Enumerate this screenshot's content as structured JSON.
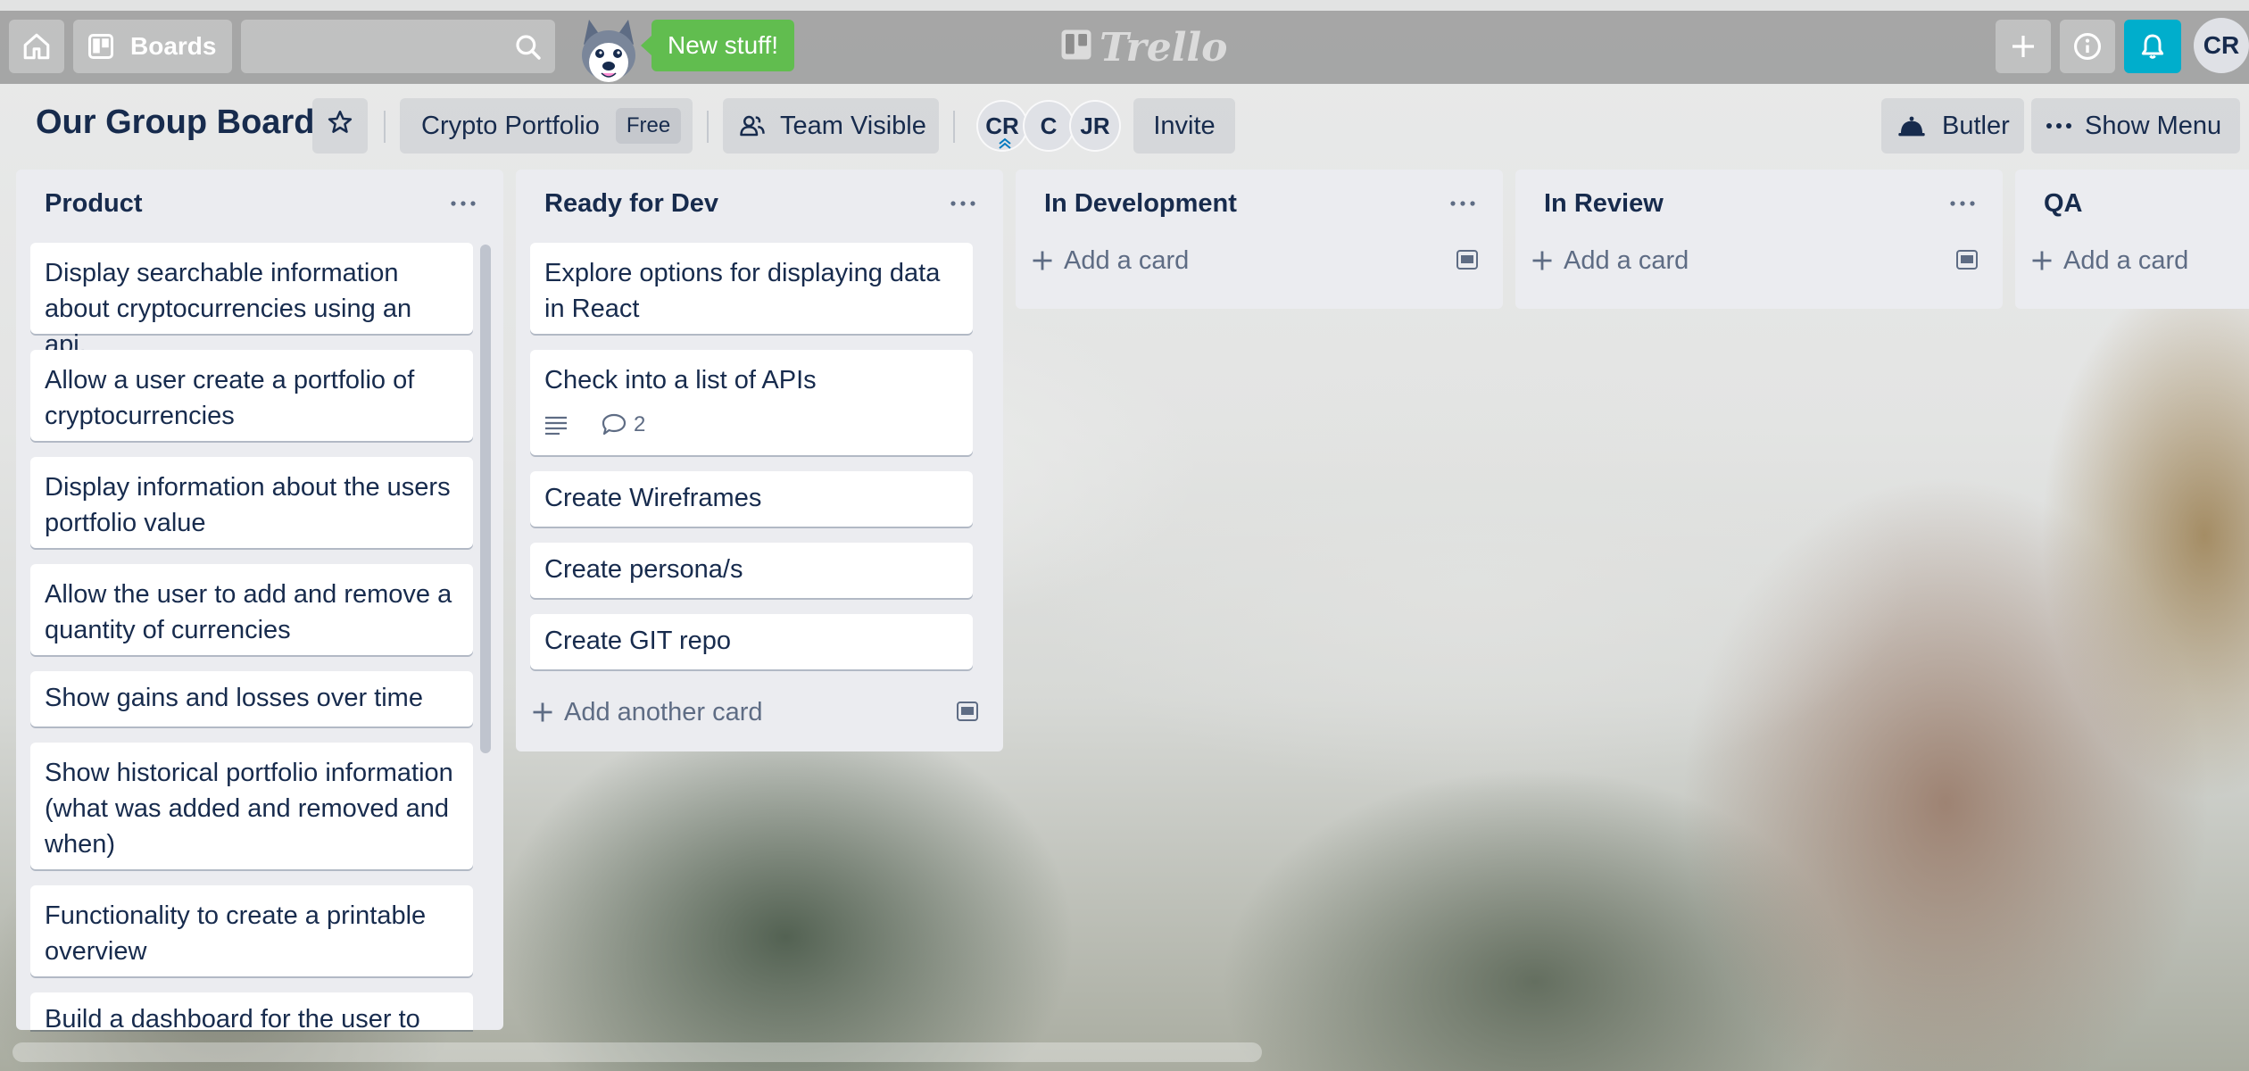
{
  "header": {
    "home_icon": "home-icon",
    "boards_label": "Boards",
    "search": {
      "value": "",
      "placeholder": ""
    },
    "new_stuff_label": "New stuff!",
    "logo_text": "Trello",
    "user_initials": "CR"
  },
  "board": {
    "title": "Our Group Board",
    "workspace_name": "Crypto Portfolio",
    "workspace_badge": "Free",
    "visibility_label": "Team Visible",
    "members": [
      "CR",
      "C",
      "JR"
    ],
    "invite_label": "Invite",
    "butler_label": "Butler",
    "show_menu_label": "Show Menu"
  },
  "lists": [
    {
      "title": "Product",
      "cards": [
        "Display searchable information about cryptocurrencies using an api.",
        "Allow a user create a portfolio of cryptocurrencies",
        "Display information about the users portfolio value",
        "Allow the user to add and remove a quantity of currencies",
        "Show gains and losses over time",
        "Show historical portfolio information (what was added and removed and when)",
        "Functionality to create a printable overview",
        "Build a dashboard for the user to"
      ]
    },
    {
      "title": "Ready for Dev",
      "cards": [
        "Explore options for displaying data in React",
        "Check into a list of APIs",
        "Create Wireframes",
        "Create persona/s",
        "Create GIT repo"
      ],
      "card2_comment_count": "2",
      "add_label": "Add another card"
    },
    {
      "title": "In Development",
      "add_label": "Add a card"
    },
    {
      "title": "In Review",
      "add_label": "Add a card"
    },
    {
      "title": "QA",
      "add_label": "Add a card"
    }
  ],
  "colors": {
    "header_bg": "#7d7d7d",
    "new_stuff": "#61bd4f",
    "notification": "#00aecc",
    "list_bg": "#ebecf0",
    "text": "#172b4d",
    "muted": "#5e6c84"
  }
}
